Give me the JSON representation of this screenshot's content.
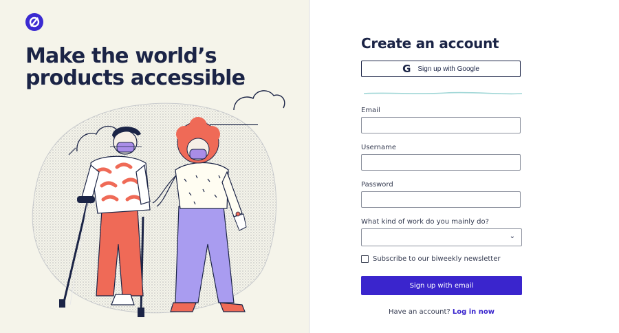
{
  "hero": {
    "headline": "Make the world’s\nproducts accessible"
  },
  "form": {
    "title": "Create an account",
    "google_button": "Sign up with Google",
    "fields": [
      {
        "label": "Email",
        "value": "",
        "placeholder": ""
      },
      {
        "label": "Username",
        "value": "",
        "placeholder": ""
      },
      {
        "label": "Password",
        "value": "",
        "placeholder": ""
      }
    ],
    "work_select": {
      "label": "What kind of work do you mainly do?",
      "value": ""
    },
    "newsletter": {
      "label": "Subscribe to our biweekly newsletter",
      "checked": false
    },
    "submit_label": "Sign up with email",
    "login_prompt": "Have an account?",
    "login_link": "Log in now"
  },
  "icons": {
    "logo": "logo-icon",
    "google": "google-icon",
    "chevron": "chevron-down-icon"
  },
  "colors": {
    "accent": "#3a25cd",
    "navy": "#1b2446",
    "left_bg": "#f5f4ea"
  }
}
